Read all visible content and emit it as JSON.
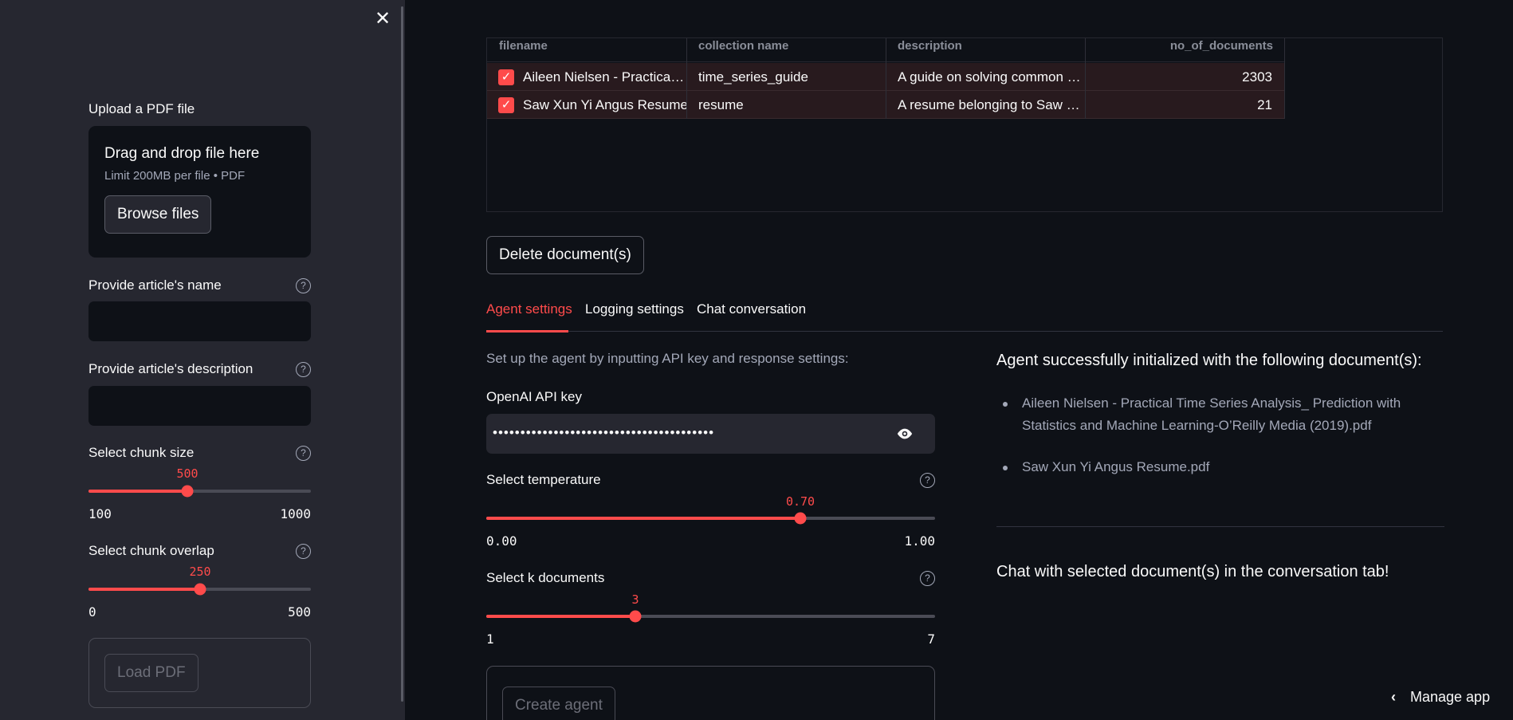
{
  "sidebar": {
    "close_icon": "close-icon",
    "upload": {
      "label": "Upload a PDF file",
      "drop_title": "Drag and drop file here",
      "drop_sub": "Limit 200MB per file • PDF",
      "browse_label": "Browse files"
    },
    "article_name": {
      "label": "Provide article's name",
      "value": ""
    },
    "article_desc": {
      "label": "Provide article's description",
      "value": ""
    },
    "chunk_size": {
      "label": "Select chunk size",
      "value": "500",
      "min": "100",
      "max": "1000",
      "fraction": 0.444
    },
    "chunk_overlap": {
      "label": "Select chunk overlap",
      "value": "250",
      "min": "0",
      "max": "500",
      "fraction": 0.5
    },
    "load_pdf_label": "Load PDF"
  },
  "table": {
    "columns": [
      "filename",
      "collection name",
      "description",
      "no_of_documents"
    ],
    "rows": [
      {
        "filename": "Aileen Nielsen - Practica…",
        "collection": "time_series_guide",
        "description": "A guide on solving common …",
        "count": "2303",
        "checked": true
      },
      {
        "filename": "Saw Xun Yi Angus Resume",
        "collection": "resume",
        "description": "A resume belonging to Saw …",
        "count": "21",
        "checked": true
      }
    ]
  },
  "delete_button": "Delete document(s)",
  "tabs": [
    "Agent settings",
    "Logging settings",
    "Chat conversation"
  ],
  "agent": {
    "intro": "Set up the agent by inputting API key and response settings:",
    "api_key_label": "OpenAI API key",
    "api_key_masked": "••••••••••••••••••••••••••••••••••••••••",
    "temperature": {
      "label": "Select temperature",
      "value": "0.70",
      "min": "0.00",
      "max": "1.00",
      "fraction": 0.7
    },
    "k_docs": {
      "label": "Select k documents",
      "value": "3",
      "min": "1",
      "max": "7",
      "fraction": 0.333
    },
    "create_label": "Create agent"
  },
  "status": {
    "heading": "Agent successfully initialized with the following document(s):",
    "documents": [
      "Aileen Nielsen - Practical Time Series Analysis_ Prediction with Statistics and Machine Learning-O’Reilly Media (2019).pdf",
      "Saw Xun Yi Angus Resume.pdf"
    ],
    "chat_hint": "Chat with selected document(s) in the conversation tab!"
  },
  "manage_app": "Manage app",
  "colors": {
    "accent": "#ff4b4b",
    "sidebar_bg": "#262730",
    "main_bg": "#0e1117"
  }
}
